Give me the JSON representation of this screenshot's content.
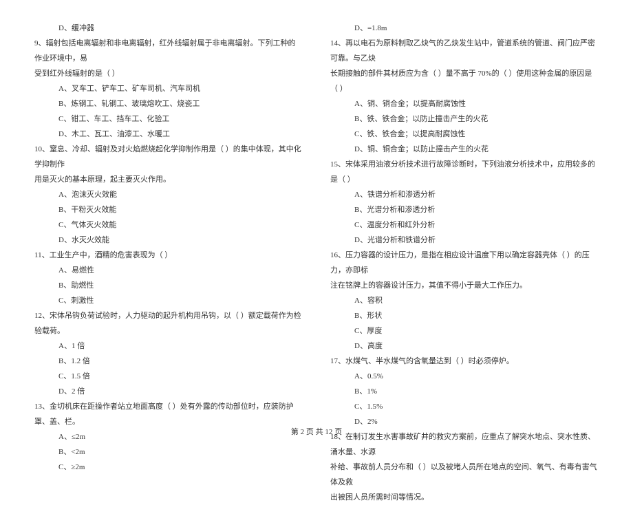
{
  "left_column": {
    "lines": [
      {
        "cls": "option-line",
        "text": "D、缓冲器"
      },
      {
        "cls": "question-line",
        "text": "9、辐射包括电离辐射和非电离辐射，红外线辐射属于非电离辐射。下列工种的作业环境中，易"
      },
      {
        "cls": "sub-line",
        "text": "受到红外线辐射的是（    ）"
      },
      {
        "cls": "option-line",
        "text": "A、叉车工、铲车工、矿车司机、汽车司机"
      },
      {
        "cls": "option-line",
        "text": "B、炼钢工、轧钢工、玻璃熔吹工、烧瓷工"
      },
      {
        "cls": "option-line",
        "text": "C、钳工、车工、挡车工、化验工"
      },
      {
        "cls": "option-line",
        "text": "D、木工、瓦工、油漆工、水暖工"
      },
      {
        "cls": "question-line",
        "text": "10、窒息、冷却、辐射及对火焰燃烧起化学抑制作用是（    ）的集中体现，其中化学抑制作"
      },
      {
        "cls": "sub-line",
        "text": "用是灭火的基本原理，起主要灭火作用。"
      },
      {
        "cls": "option-line",
        "text": "A、泡沫灭火效能"
      },
      {
        "cls": "option-line",
        "text": "B、干粉灭火效能"
      },
      {
        "cls": "option-line",
        "text": "C、气体灭火效能"
      },
      {
        "cls": "option-line",
        "text": "D、水灭火效能"
      },
      {
        "cls": "question-line",
        "text": "11、工业生产中，酒精的危害表现为（    ）"
      },
      {
        "cls": "option-line",
        "text": "A、易燃性"
      },
      {
        "cls": "option-line",
        "text": "B、助燃性"
      },
      {
        "cls": "option-line",
        "text": "C、刺激性"
      },
      {
        "cls": "question-line",
        "text": "12、宋体吊钩负荷试验时，人力驱动的起升机构用吊钩，以（    ）额定载荷作为检验载荷。"
      },
      {
        "cls": "option-line",
        "text": "A、1 倍"
      },
      {
        "cls": "option-line",
        "text": "B、1.2 倍"
      },
      {
        "cls": "option-line",
        "text": "C、1.5 倍"
      },
      {
        "cls": "option-line",
        "text": "D、2 倍"
      },
      {
        "cls": "question-line",
        "text": "13、金切机床在距操作者站立地面高度（    ）处有外露的传动部位时，应装防护罩、盖、栏。"
      },
      {
        "cls": "option-line",
        "text": "A、≤2m"
      },
      {
        "cls": "option-line",
        "text": "B、<2m"
      },
      {
        "cls": "option-line",
        "text": "C、≥2m"
      }
    ]
  },
  "right_column": {
    "lines": [
      {
        "cls": "option-line",
        "text": "D、=1.8m"
      },
      {
        "cls": "question-line",
        "text": "14、再以电石为原料制取乙炔气的乙炔发生站中，管道系统的管道、阀门应严密可靠。与乙炔"
      },
      {
        "cls": "sub-line",
        "text": "长期接触的部件其材质应为含（    ）量不高于 70%的（    ）使用这种金属的原因是（    ）"
      },
      {
        "cls": "option-line",
        "text": "A、铜、铜合金；以提高耐腐蚀性"
      },
      {
        "cls": "option-line",
        "text": "B、铁、铁合金；以防止撞击产生的火花"
      },
      {
        "cls": "option-line",
        "text": "C、铁、铁合金；以提高耐腐蚀性"
      },
      {
        "cls": "option-line",
        "text": "D、铜、铜合金；以防止撞击产生的火花"
      },
      {
        "cls": "question-line",
        "text": "15、宋体采用油液分析技术进行故障诊断时，下列油液分析技术中，应用较多的是（    ）"
      },
      {
        "cls": "option-line",
        "text": "A、铁谱分析和渗透分析"
      },
      {
        "cls": "option-line",
        "text": "B、光谱分析和渗透分析"
      },
      {
        "cls": "option-line",
        "text": "C、温度分析和红外分析"
      },
      {
        "cls": "option-line",
        "text": "D、光谱分析和铁谱分析"
      },
      {
        "cls": "question-line",
        "text": "16、压力容器的设计压力，是指在相应设计温度下用以确定容器壳体（    ）的压力，亦即标"
      },
      {
        "cls": "sub-line",
        "text": "注在铭牌上的容器设计压力，其值不得小于最大工作压力。"
      },
      {
        "cls": "option-line",
        "text": "A、容积"
      },
      {
        "cls": "option-line",
        "text": "B、形状"
      },
      {
        "cls": "option-line",
        "text": "C、厚度"
      },
      {
        "cls": "option-line",
        "text": "D、高度"
      },
      {
        "cls": "question-line",
        "text": "17、水煤气、半水煤气的含氧量达到（    ）时必须停炉。"
      },
      {
        "cls": "option-line",
        "text": "A、0.5%"
      },
      {
        "cls": "option-line",
        "text": "B、1%"
      },
      {
        "cls": "option-line",
        "text": "C、1.5%"
      },
      {
        "cls": "option-line",
        "text": "D、2%"
      },
      {
        "cls": "question-line",
        "text": "18、在制订发生水害事故矿井的救灾方案前，应重点了解突水地点、突水性质、涌水量、水源"
      },
      {
        "cls": "sub-line",
        "text": "补给、事故前人员分布和（    ）以及被堵人员所在地点的空间、氧气、有毒有害气体及救"
      },
      {
        "cls": "sub-line",
        "text": "出被困人员所需时间等情况。"
      }
    ]
  },
  "footer": "第 2 页 共 12 页"
}
